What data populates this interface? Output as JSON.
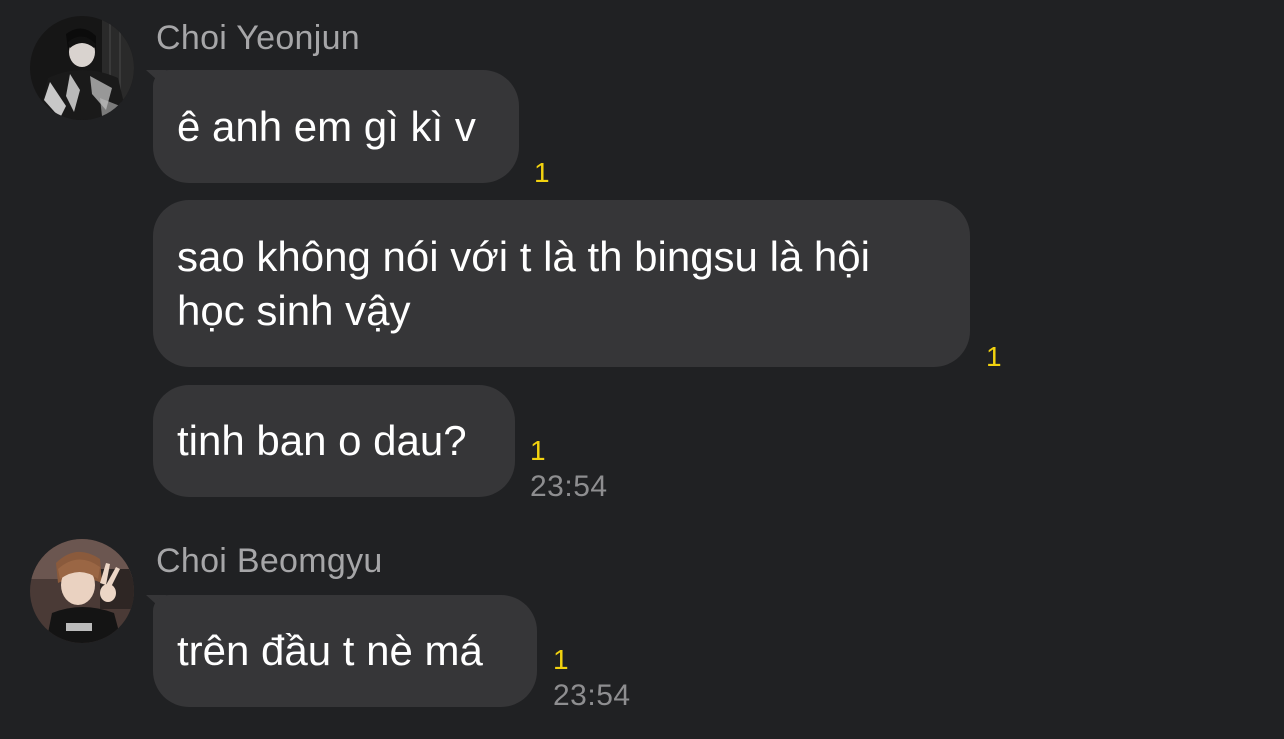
{
  "groups": [
    {
      "sender": "Choi Yeonjun",
      "avatar": "avatar-choi-yeonjun",
      "messages": [
        {
          "text_lines": [
            "ê anh em gì kì v"
          ],
          "unread": "1"
        },
        {
          "text_lines": [
            "sao không nói với t là th bingsu là hội",
            "học sinh vậy"
          ],
          "unread": "1"
        },
        {
          "text_lines": [
            "tinh ban o dau?"
          ],
          "unread": "1",
          "time": "23:54"
        }
      ]
    },
    {
      "sender": "Choi Beomgyu",
      "avatar": "avatar-choi-beomgyu",
      "messages": [
        {
          "text_lines": [
            "trên đầu t nè má"
          ],
          "unread": "1",
          "time": "23:54"
        }
      ]
    }
  ],
  "colors": {
    "background": "#202123",
    "bubble": "#363638",
    "message_text": "#ffffff",
    "sender_name": "#a6a6a8",
    "unread_count": "#f2d20f",
    "timestamp": "#8e8e90"
  }
}
